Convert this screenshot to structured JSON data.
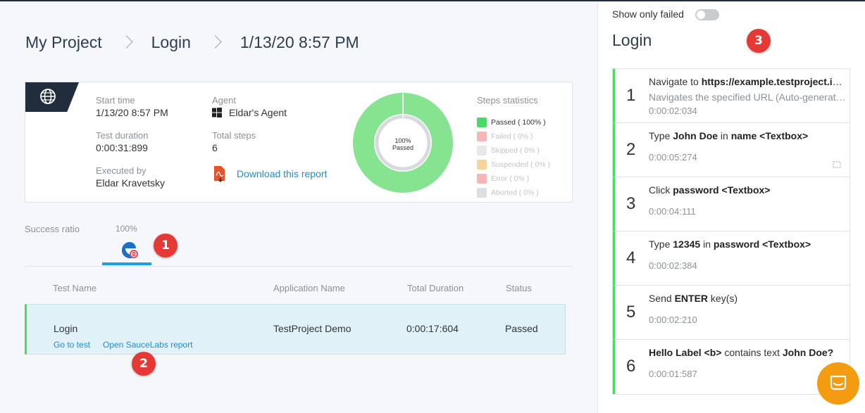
{
  "breadcrumb": [
    "My Project",
    "Login",
    "1/13/20 8:57 PM"
  ],
  "summary": {
    "start_time_label": "Start time",
    "start_time": "1/13/20 8:57 PM",
    "duration_label": "Test duration",
    "duration": "0:00:31:899",
    "executed_by_label": "Executed by",
    "executed_by": "Eldar Kravetsky",
    "agent_label": "Agent",
    "agent": "Eldar's Agent",
    "total_steps_label": "Total steps",
    "total_steps": "6",
    "download_label": "Download this report",
    "donut_pct": "100%",
    "donut_status": "Passed",
    "stats_title": "Steps statistics",
    "stats": [
      {
        "label": "Passed ( 100% )",
        "color": "#4cd964",
        "on": true
      },
      {
        "label": "Failed ( 0% )",
        "color": "#f4b6b6",
        "on": false
      },
      {
        "label": "Skipped ( 0% )",
        "color": "#e6e8ea",
        "on": false
      },
      {
        "label": "Suspended ( 0% )",
        "color": "#f7d49a",
        "on": false
      },
      {
        "label": "Error ( 0% )",
        "color": "#f4b6b6",
        "on": false
      },
      {
        "label": "Aborted ( 0% )",
        "color": "#dcdfe2",
        "on": false
      }
    ]
  },
  "success": {
    "label": "Success ratio",
    "value": "100%"
  },
  "badges": {
    "b1": "1",
    "b2": "2",
    "b3": "3"
  },
  "table": {
    "headers": [
      "Test Name",
      "Application Name",
      "Total Duration",
      "Status"
    ],
    "row": {
      "name": "Login",
      "app": "TestProject Demo",
      "duration": "0:00:17:604",
      "status": "Passed",
      "link1": "Go to test",
      "link2": "Open SauceLabs report"
    }
  },
  "panel": {
    "toggle_label": "Show only failed",
    "title": "Login",
    "steps": [
      {
        "n": "1",
        "time": "0:00:02:034",
        "sub": "Navigates the specified URL (Auto-generated)"
      },
      {
        "n": "2",
        "time": "0:00:05:274"
      },
      {
        "n": "3",
        "time": "0:00:04:111"
      },
      {
        "n": "4",
        "time": "0:00:02:384"
      },
      {
        "n": "5",
        "time": "0:00:02:210"
      },
      {
        "n": "6",
        "time": "0:00:01:587"
      }
    ],
    "step_text": {
      "s1a": "Navigate to ",
      "s1b": "https://example.testproject.io/web/",
      "s2a": "Type ",
      "s2b": "John Doe",
      "s2c": " in ",
      "s2d": "name <Textbox>",
      "s3a": "Click ",
      "s3b": "password <Textbox>",
      "s4a": "Type ",
      "s4b": "12345",
      "s4c": " in ",
      "s4d": "password <Textbox>",
      "s5a": "Send ",
      "s5b": "ENTER",
      "s5c": " key(s)",
      "s6a": "Hello Label <b>",
      "s6b": " contains text ",
      "s6c": "John Doe?"
    }
  }
}
